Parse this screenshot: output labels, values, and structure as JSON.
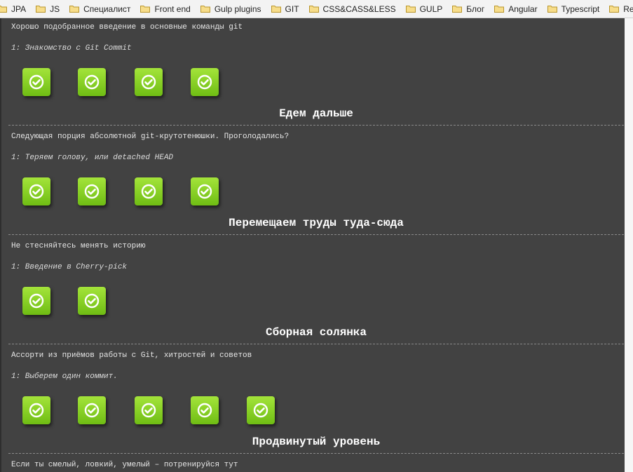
{
  "bookmarks": [
    {
      "label": "JPA"
    },
    {
      "label": "JS"
    },
    {
      "label": "Специалист"
    },
    {
      "label": "Front end"
    },
    {
      "label": "Gulp plugins"
    },
    {
      "label": "GIT"
    },
    {
      "label": "CSS&CASS&LESS"
    },
    {
      "label": "GULP"
    },
    {
      "label": "Блог"
    },
    {
      "label": "Angular"
    },
    {
      "label": "Typescript"
    },
    {
      "label": "React"
    }
  ],
  "sections": [
    {
      "description": "Хорошо подобранное введение в основные команды git",
      "level_name": "1: Знакомство с Git Commit",
      "completed_levels": 4
    },
    {
      "heading": "Едем дальше",
      "description": "Следующая порция абсолютной git-крутотенюшки. Проголодались?",
      "level_name": "1: Теряем голову, или detached HEAD",
      "completed_levels": 4
    },
    {
      "heading": "Перемещаем труды туда-сюда",
      "description": "Не стесняйтесь менять историю",
      "level_name": "1: Введение в Cherry-pick",
      "completed_levels": 2
    },
    {
      "heading": "Сборная солянка",
      "description": "Ассорти из приёмов работы с Git, хитростей и советов",
      "level_name": "1: Выберем один коммит.",
      "completed_levels": 5
    },
    {
      "heading": "Продвинутый уровень",
      "description": "Если ты смелый, ловкий, умелый – потренируйся тут"
    }
  ],
  "colors": {
    "badge_green": "#8fd628",
    "background": "#424242",
    "text": "#e6e6e6"
  },
  "icons": {
    "folder": "folder-icon",
    "badge": "checkmark-icon"
  }
}
